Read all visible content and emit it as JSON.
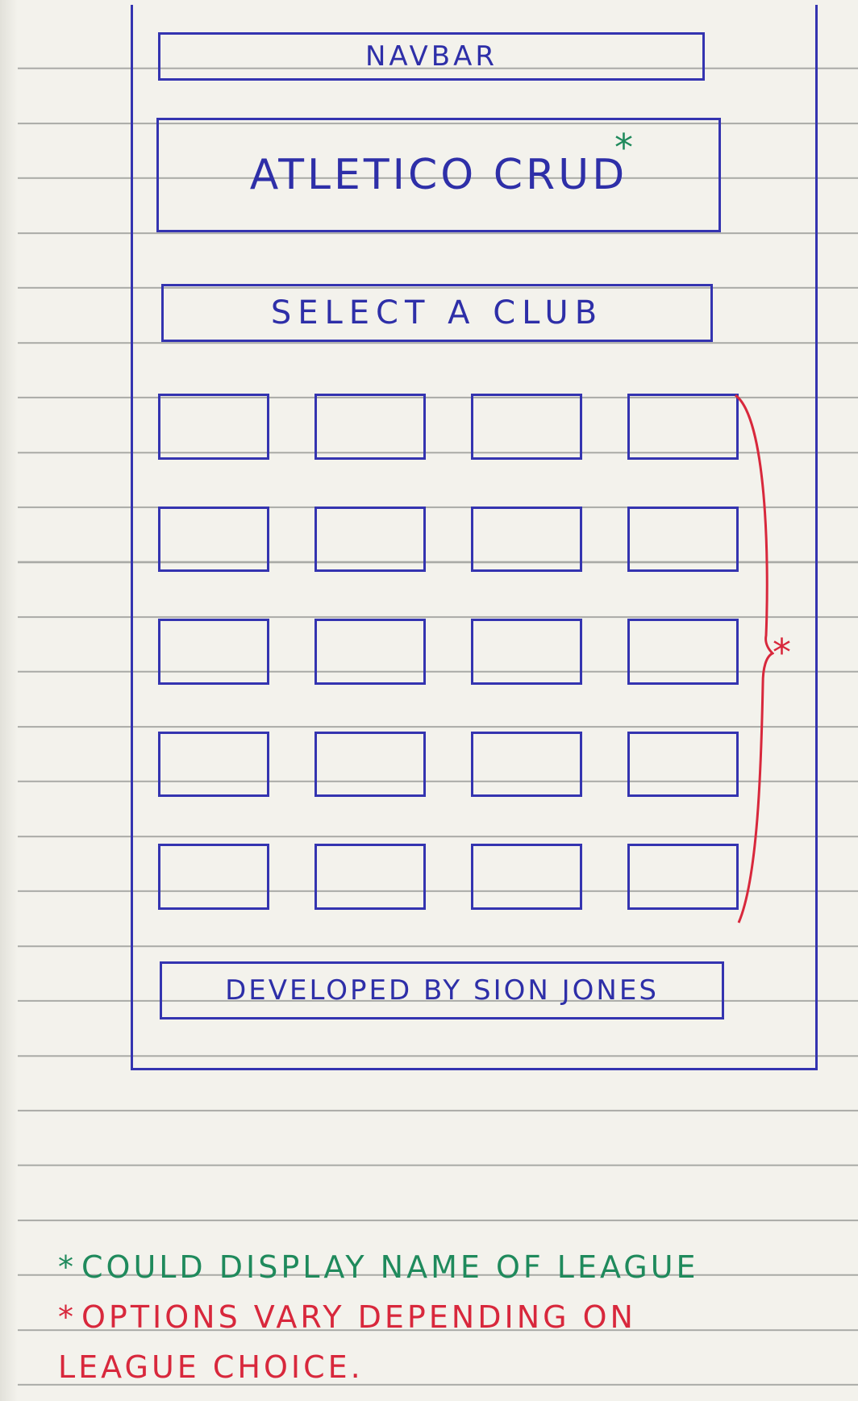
{
  "navbar": {
    "label": "NAVBAR"
  },
  "hero": {
    "title": "ATLETICO CRUD",
    "marker": "*"
  },
  "club_select": {
    "label": "SELECT A CLUB"
  },
  "club_grid": {
    "rows": 5,
    "columns": 4,
    "marker": "*"
  },
  "footer": {
    "text": "DEVELOPED BY SION JONES"
  },
  "notes": [
    {
      "marker": "*",
      "text": "COULD DISPLAY NAME OF LEAGUE",
      "color": "#1f8a5c"
    },
    {
      "marker": "*",
      "text": "OPTIONS VARY DEPENDING ON LEAGUE CHOICE.",
      "color": "#d8283c"
    }
  ],
  "colors": {
    "ink_blue": "#3434b0",
    "note_green": "#1f8a5c",
    "note_red": "#d8283c",
    "paper": "#f3f2ec"
  }
}
